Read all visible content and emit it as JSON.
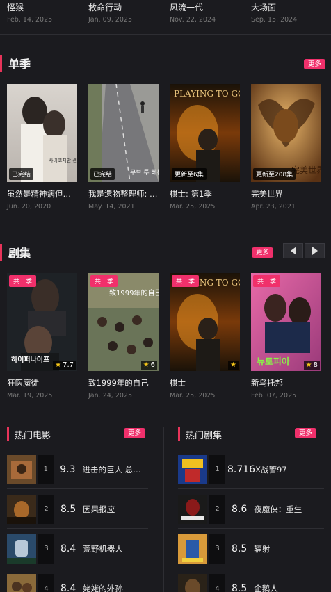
{
  "colors": {
    "accent": "#f0306b",
    "background": "#1b1b1f",
    "muted_text": "#777777"
  },
  "top_row": [
    {
      "title": "怪猴",
      "date": "Feb. 14, 2025"
    },
    {
      "title": "救命行动",
      "date": "Jan. 09, 2025"
    },
    {
      "title": "风流一代",
      "date": "Nov. 22, 2024"
    },
    {
      "title": "大场面",
      "date": "Sep. 15, 2024"
    }
  ],
  "season": {
    "title": "单季",
    "more": "更多",
    "items": [
      {
        "name": "虽然是精神病但没关系",
        "date": "Jun. 20, 2020",
        "status": "已完结",
        "poster_text": "사이코지만 괜찮아"
      },
      {
        "name": "我是遗物整理师: 第一季",
        "date": "May. 14, 2021",
        "status": "已完结",
        "poster_text": "무브 투 헤븐"
      },
      {
        "name": "棋士: 第1季",
        "date": "Mar. 25, 2025",
        "status": "更新至6集",
        "poster_text": "PLAYING TO GO"
      },
      {
        "name": "完美世界",
        "date": "Apr. 23, 2021",
        "status": "更新至208集",
        "poster_text": "完美世界"
      }
    ]
  },
  "series": {
    "title": "剧集",
    "more": "更多",
    "items": [
      {
        "name": "狂医魔徒",
        "date": "Mar. 19, 2025",
        "badge": "共一季",
        "rating": "7.7",
        "poster_text": "하이퍼나이프"
      },
      {
        "name": "致1999年的自己",
        "date": "Jan. 24, 2025",
        "badge": "共一季",
        "rating": "6",
        "poster_text": "致1999年的自己"
      },
      {
        "name": "棋士",
        "date": "Mar. 25, 2025",
        "badge": "共一季",
        "rating": "",
        "poster_text": "PLAYING TO GO"
      },
      {
        "name": "新乌托邦",
        "date": "Feb. 07, 2025",
        "badge": "共一季",
        "rating": "8",
        "poster_text": "뉴토피아"
      }
    ]
  },
  "hot_movies": {
    "title": "热门电影",
    "more": "更多",
    "items": [
      {
        "rank": "1",
        "score": "9.3",
        "name": "进击的巨人 总集篇"
      },
      {
        "rank": "2",
        "score": "8.5",
        "name": "因果报应"
      },
      {
        "rank": "3",
        "score": "8.4",
        "name": "荒野机器人"
      },
      {
        "rank": "4",
        "score": "8.4",
        "name": "姥姥的外孙"
      }
    ]
  },
  "hot_series": {
    "title": "热门剧集",
    "more": "更多",
    "items": [
      {
        "rank": "1",
        "score": "8.716",
        "name": "X战警97"
      },
      {
        "rank": "2",
        "score": "8.6",
        "name": "夜魔侠：重生"
      },
      {
        "rank": "3",
        "score": "8.5",
        "name": "辐射"
      },
      {
        "rank": "4",
        "score": "8.5",
        "name": "企鹅人"
      }
    ]
  }
}
